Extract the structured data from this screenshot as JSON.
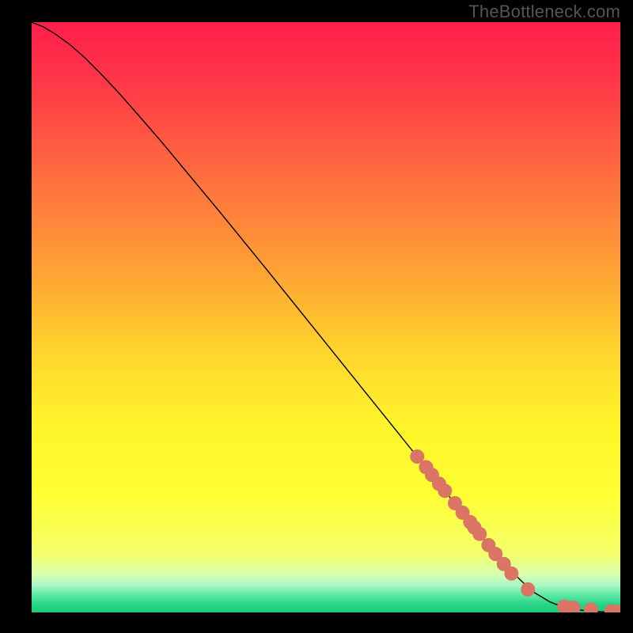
{
  "attribution": "TheBottleneck.com",
  "chart_data": {
    "type": "line",
    "title": "",
    "xlabel": "",
    "ylabel": "",
    "xlim": [
      0,
      100
    ],
    "ylim": [
      0,
      100
    ],
    "grid": false,
    "background": "vertical-gradient",
    "gradient_stops": [
      {
        "offset": 0.0,
        "color": "#ff1f4b"
      },
      {
        "offset": 0.1,
        "color": "#ff3747"
      },
      {
        "offset": 0.25,
        "color": "#ff6a3f"
      },
      {
        "offset": 0.4,
        "color": "#ff9a36"
      },
      {
        "offset": 0.55,
        "color": "#ffd22e"
      },
      {
        "offset": 0.68,
        "color": "#fff42a"
      },
      {
        "offset": 0.8,
        "color": "#ffff33"
      },
      {
        "offset": 0.9,
        "color": "#f4ff6a"
      },
      {
        "offset": 0.935,
        "color": "#d8ffae"
      },
      {
        "offset": 0.955,
        "color": "#a8f7c6"
      },
      {
        "offset": 0.97,
        "color": "#5eeaa5"
      },
      {
        "offset": 0.985,
        "color": "#2bd68a"
      },
      {
        "offset": 1.0,
        "color": "#17cc7a"
      }
    ],
    "series": [
      {
        "name": "bottleneck-curve",
        "type": "line",
        "color": "#000000",
        "x": [
          0.0,
          2.0,
          4.0,
          6.5,
          9.0,
          12.0,
          15.0,
          18.0,
          22.0,
          26.0,
          32.0,
          40.0,
          50.0,
          60.0,
          70.0,
          80.0,
          85.0,
          88.0,
          90.0,
          92.0,
          94.0,
          96.0,
          98.0,
          100.0
        ],
        "y": [
          100.0,
          99.2,
          98.0,
          96.2,
          94.0,
          91.0,
          87.8,
          84.4,
          79.8,
          75.0,
          67.8,
          58.0,
          45.6,
          33.2,
          20.8,
          8.4,
          3.6,
          1.8,
          1.0,
          0.6,
          0.3,
          0.15,
          0.05,
          0.0
        ]
      },
      {
        "name": "highlight-dots",
        "type": "scatter",
        "color": "#da7566",
        "radius_px": 9,
        "x": [
          65.5,
          67.0,
          68.0,
          69.2,
          70.2,
          71.9,
          73.2,
          74.5,
          75.2,
          76.1,
          77.6,
          78.8,
          80.2,
          81.5,
          84.3,
          90.5,
          92.0,
          95.0,
          98.5,
          99.5
        ],
        "y": [
          26.4,
          24.6,
          23.3,
          21.8,
          20.6,
          18.5,
          16.9,
          15.3,
          14.4,
          13.3,
          11.4,
          9.9,
          8.2,
          6.6,
          3.9,
          1.0,
          0.8,
          0.5,
          0.2,
          0.1
        ]
      }
    ]
  }
}
